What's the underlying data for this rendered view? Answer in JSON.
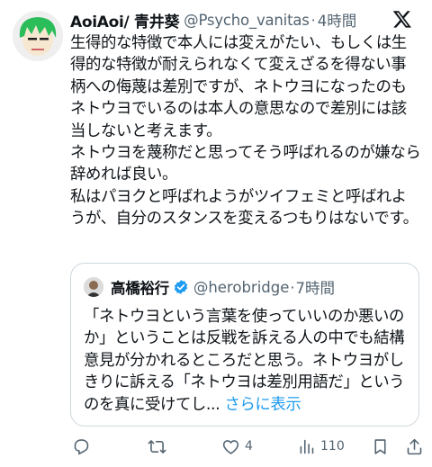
{
  "tweet": {
    "display_name": "AoiAoi/ 青井葵",
    "handle": "@Psycho_vanitas",
    "separator": "·",
    "time": "4時間",
    "text": "生得的な特徴で本人には変えがたい、もしくは生得的な特徴が耐えられなくて変えざるを得ない事柄への侮蔑は差別ですが、ネトウヨになったのもネトウヨでいるのは本人の意思なので差別には該当しないと考えます。\nネトウヨを蔑称だと思ってそう呼ばれるのが嫌なら辞めれば良い。\n私はパヨクと呼ばれようがツイフェミと呼ばれようが、自分のスタンスを変えるつもりはないです。"
  },
  "quote": {
    "display_name": "高橋裕行",
    "handle": "@herobridge",
    "separator": "·",
    "time": "7時間",
    "text": "「ネトウヨという言葉を使っていいのか悪いのか」ということは反戦を訴える人の中でも結構意見が分かれるところだと思う。ネトウヨがしきりに訴える「ネトウヨは差別用語だ」というのを真に受けてし...",
    "more_label": " さらに表示"
  },
  "actions": {
    "reply_count": "",
    "retweet_count": "",
    "like_count": "4",
    "views_count": "110"
  },
  "icons": {
    "logo": "x-logo-icon",
    "verified": "verified-badge-icon",
    "reply": "reply-icon",
    "retweet": "retweet-icon",
    "like": "heart-icon",
    "views": "views-icon",
    "bookmark": "bookmark-icon",
    "share": "share-icon"
  },
  "colors": {
    "link": "#1d9bf0",
    "secondary_text": "#536471",
    "border": "#cfd9de",
    "avatar_hair": "#2bbd5a"
  }
}
